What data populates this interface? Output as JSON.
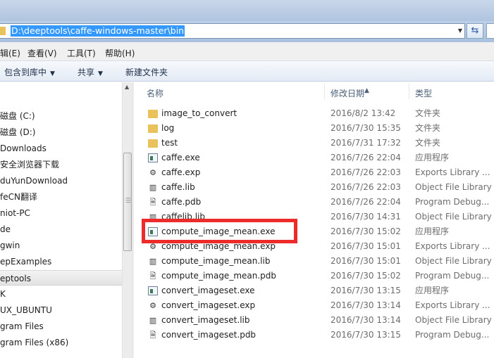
{
  "address_bar": {
    "path": "D:\\deeptools\\caffe-windows-master\\bin"
  },
  "menu": [
    "编辑(E)",
    "查看(V)",
    "工具(T)",
    "帮助(H)"
  ],
  "menu_visible": [
    "辑(E)",
    "查看(V)",
    "工具(T)",
    "帮助(H)"
  ],
  "toolbar": {
    "include_library": "包含到库中",
    "share": "共享",
    "new_folder": "新建文件夹"
  },
  "nav": {
    "items": [
      "磁盘 (C:)",
      "磁盘 (D:)",
      "Downloads",
      "安全浏览器下载",
      "duYunDownload",
      "feCN翻译",
      "niot-PC",
      "de",
      "gwin",
      "epExamples",
      "eptools",
      "K",
      "UX_UBUNTU",
      "gram Files",
      "gram Files (x86)"
    ],
    "selected_index": 10
  },
  "columns": {
    "name": "名称",
    "date": "修改日期",
    "type": "类型"
  },
  "files": [
    {
      "name": "image_to_convert",
      "date": "2016/8/2 13:42",
      "type": "文件夹",
      "icon": "folder"
    },
    {
      "name": "log",
      "date": "2016/7/30 15:35",
      "type": "文件夹",
      "icon": "folder"
    },
    {
      "name": "test",
      "date": "2016/7/31 17:32",
      "type": "文件夹",
      "icon": "folder"
    },
    {
      "name": "caffe.exe",
      "date": "2016/7/26 22:04",
      "type": "应用程序",
      "icon": "exe"
    },
    {
      "name": "caffe.exp",
      "date": "2016/7/26 22:03",
      "type": "Exports Library ...",
      "icon": "exp"
    },
    {
      "name": "caffe.lib",
      "date": "2016/7/26 22:03",
      "type": "Object File Library",
      "icon": "lib"
    },
    {
      "name": "caffe.pdb",
      "date": "2016/7/26 22:04",
      "type": "Program Debug...",
      "icon": "pdb"
    },
    {
      "name": "caffelib.lib",
      "date": "2016/7/30 14:31",
      "type": "Object File Library",
      "icon": "lib"
    },
    {
      "name": "compute_image_mean.exe",
      "date": "2016/7/30 15:02",
      "type": "应用程序",
      "icon": "exe"
    },
    {
      "name": "compute_image_mean.exp",
      "date": "2016/7/30 15:01",
      "type": "Exports Library ...",
      "icon": "exp"
    },
    {
      "name": "compute_image_mean.lib",
      "date": "2016/7/30 15:01",
      "type": "Object File Library",
      "icon": "lib"
    },
    {
      "name": "compute_image_mean.pdb",
      "date": "2016/7/30 15:02",
      "type": "Program Debug...",
      "icon": "pdb"
    },
    {
      "name": "convert_imageset.exe",
      "date": "2016/7/30 13:15",
      "type": "应用程序",
      "icon": "exe"
    },
    {
      "name": "convert_imageset.exp",
      "date": "2016/7/30 13:14",
      "type": "Exports Library ...",
      "icon": "exp"
    },
    {
      "name": "convert_imageset.lib",
      "date": "2016/7/30 13:14",
      "type": "Object File Library",
      "icon": "lib"
    },
    {
      "name": "convert_imageset.pdb",
      "date": "2016/7/30 13:15",
      "type": "Program Debug...",
      "icon": "pdb"
    }
  ],
  "highlight": {
    "file": "compute_image_mean.exe",
    "color": "#ee2b2b"
  },
  "colors": {
    "selection": "#3399ff"
  }
}
